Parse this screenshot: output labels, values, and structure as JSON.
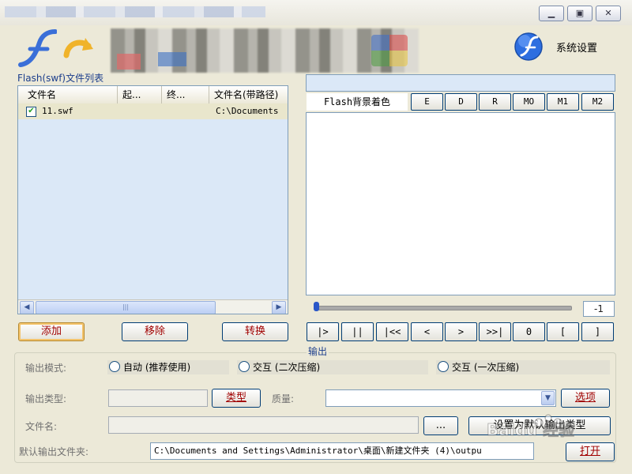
{
  "window": {
    "minimize_icon": "minimize-icon",
    "restore_icon": "restore-icon",
    "close_icon": "close-icon"
  },
  "header": {
    "settings_label": "系统设置"
  },
  "file_list": {
    "group_label": "Flash(swf)文件列表",
    "columns": [
      "文件名",
      "起...",
      "终...",
      "文件名(带路径)"
    ],
    "rows": [
      {
        "checked": true,
        "name": "11.swf",
        "start": "",
        "end": "",
        "path": "C:\\Documents"
      }
    ]
  },
  "left_buttons": {
    "add": "添加",
    "remove": "移除",
    "convert": "转换"
  },
  "preview": {
    "bg_color_label": "Flash背景着色",
    "color_buttons": [
      "E",
      "D",
      "R",
      "MO",
      "M1",
      "M2"
    ],
    "frame_value": "-1",
    "controls": [
      "|>",
      "||",
      "|<<",
      "<",
      ">",
      ">>|",
      "0",
      "[",
      "]"
    ]
  },
  "output": {
    "title": "输出",
    "mode_label": "输出模式:",
    "modes": [
      "自动 (推荐使用)",
      "交互 (二次压缩)",
      "交互 (一次压缩)"
    ],
    "type_label": "输出类型:",
    "type_button": "类型",
    "quality_label": "质量:",
    "options_button": "选项",
    "filename_label": "文件名:",
    "browse_button": "...",
    "set_default_button": "设置为默认输出类型",
    "default_folder_label": "默认输出文件夹:",
    "default_folder_value": "C:\\Documents and Settings\\Administrator\\桌面\\新建文件夹 (4)\\outpu",
    "open_button": "打开"
  },
  "watermark": "Baidu 经验"
}
